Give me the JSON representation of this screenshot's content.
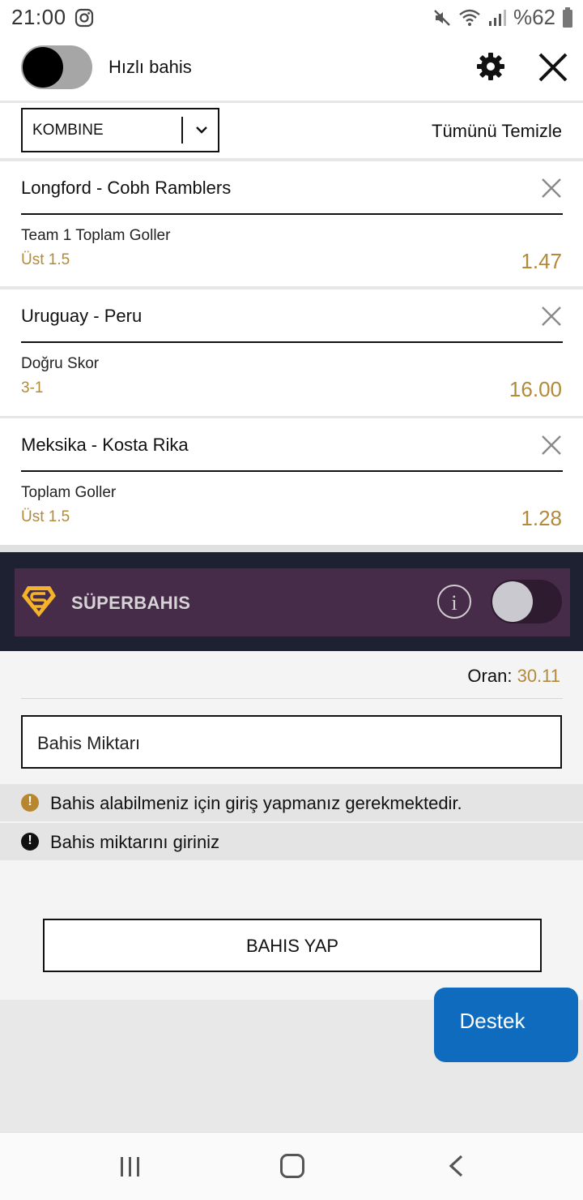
{
  "status_bar": {
    "time": "21:00",
    "battery": "%62"
  },
  "header": {
    "quick_bet_label": "Hızlı bahis"
  },
  "controls": {
    "bet_type": "KOMBINE",
    "clear_all": "Tümünü Temizle"
  },
  "bets": [
    {
      "match": "Longford - Cobh Ramblers",
      "market": "Team 1 Toplam Goller",
      "selection": "Üst 1.5",
      "odds": "1.47"
    },
    {
      "match": "Uruguay - Peru",
      "market": "Doğru Skor",
      "selection": "3-1",
      "odds": "16.00"
    },
    {
      "match": "Meksika - Kosta Rika",
      "market": "Toplam Goller",
      "selection": "Üst 1.5",
      "odds": "1.28"
    }
  ],
  "superbahis": {
    "label": "SÜPERBAHIS",
    "info_glyph": "i"
  },
  "summary": {
    "odds_label": "Oran:",
    "odds_value": "30.11",
    "stake_placeholder": "Bahis Miktarı",
    "messages": [
      {
        "text": "Bahis alabilmeniz için giriş yapmanız gerekmektedir.",
        "icon": "!",
        "color": "#b8862e"
      },
      {
        "text": "Bahis miktarını giriniz",
        "icon": "!",
        "color": "#111111"
      }
    ],
    "place_bet_label": "BAHIS YAP"
  },
  "support": {
    "label": "Destek"
  },
  "colors": {
    "accent_gold": "#b28a3a",
    "support_blue": "#0e6bbd",
    "super_bg": "#462c48",
    "super_outer": "#1d2131"
  }
}
